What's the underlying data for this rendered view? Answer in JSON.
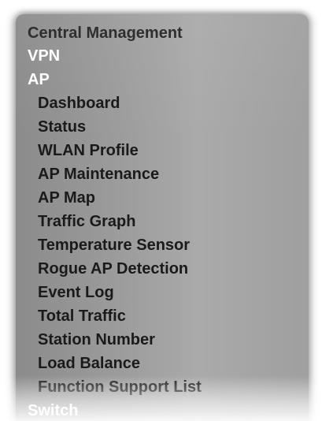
{
  "menu": {
    "top_items": [
      {
        "label": "Central Management"
      },
      {
        "label": "VPN"
      },
      {
        "label": "AP"
      }
    ],
    "ap_submenu": [
      {
        "label": "Dashboard"
      },
      {
        "label": "Status"
      },
      {
        "label": "WLAN Profile"
      },
      {
        "label": "AP Maintenance"
      },
      {
        "label": "AP Map"
      },
      {
        "label": "Traffic Graph"
      },
      {
        "label": "Temperature Sensor"
      },
      {
        "label": "Rogue AP Detection"
      },
      {
        "label": "Event Log"
      },
      {
        "label": "Total Traffic"
      },
      {
        "label": "Station Number"
      },
      {
        "label": "Load Balance"
      },
      {
        "label": "Function Support List"
      }
    ],
    "after_items": [
      {
        "label": "Switch"
      }
    ]
  }
}
